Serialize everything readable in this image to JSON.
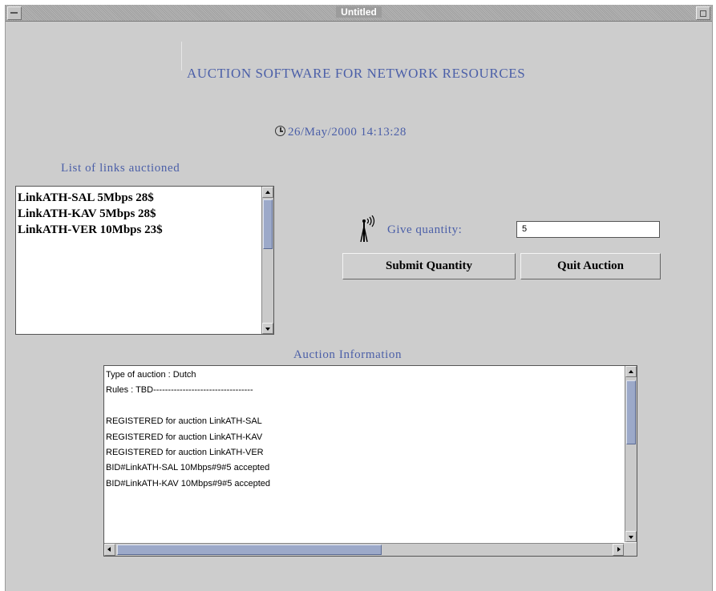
{
  "window": {
    "title": "Untitled"
  },
  "heading": "AUCTION SOFTWARE FOR NETWORK RESOURCES",
  "datetime": "26/May/2000 14:13:28",
  "links": {
    "label": "List of links auctioned",
    "items": [
      "LinkATH-SAL  5Mbps 28$",
      "LinkATH-KAV  5Mbps 28$",
      "LinkATH-VER  10Mbps 23$"
    ]
  },
  "quantity": {
    "label": "Give quantity:",
    "value": "5"
  },
  "buttons": {
    "submit": "Submit Quantity",
    "quit": "Quit Auction"
  },
  "auction_info": {
    "label": "Auction Information",
    "lines": [
      "Type of auction : Dutch",
      "Rules : TBD----------------------------------",
      "",
      "REGISTERED for auction LinkATH-SAL",
      "REGISTERED for auction LinkATH-KAV",
      "REGISTERED for auction LinkATH-VER",
      "BID#LinkATH-SAL 10Mbps#9#5 accepted",
      "BID#LinkATH-KAV 10Mbps#9#5 accepted"
    ]
  },
  "icons": [
    "minimize-icon",
    "maximize-icon",
    "clock-icon",
    "antenna-icon"
  ]
}
